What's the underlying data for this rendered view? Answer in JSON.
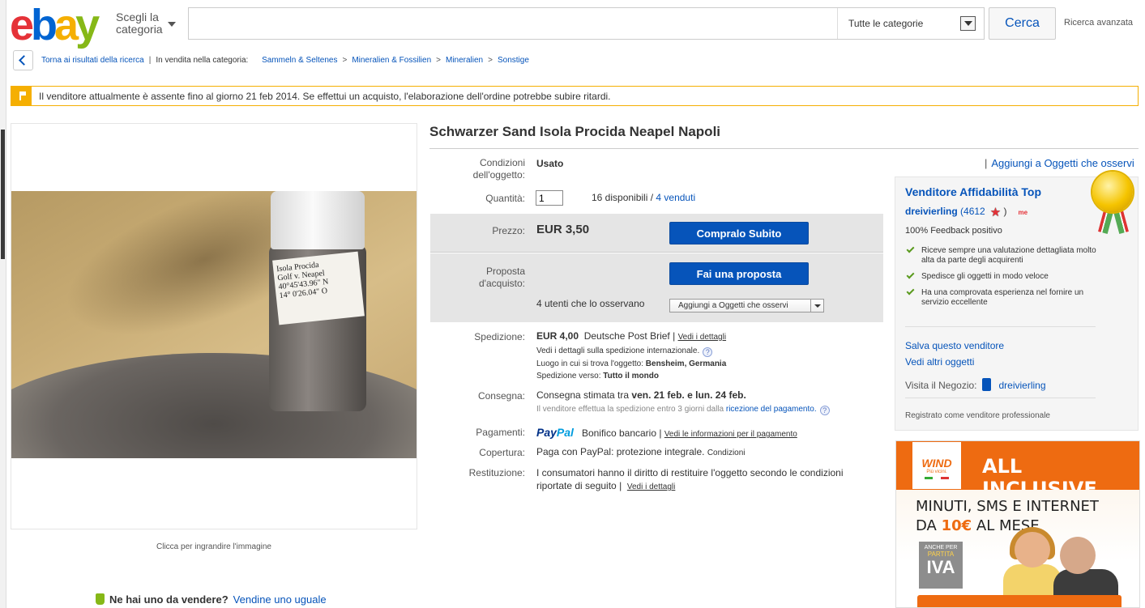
{
  "header": {
    "logo": {
      "e": "e",
      "b": "b",
      "a": "a",
      "y": "y"
    },
    "category_button": {
      "line1": "Scegli la",
      "line2": "categoria"
    },
    "search": {
      "value": "",
      "placeholder": ""
    },
    "category_select": "Tutte le categorie",
    "search_button": "Cerca",
    "advanced_search": "Ricerca avanzata"
  },
  "breadcrumb": {
    "back_label": "Torna ai risultati della ricerca",
    "prefix": "In vendita nella categoria:",
    "items": [
      "Sammeln & Seltenes",
      "Mineralien & Fossilien",
      "Mineralien",
      "Sonstige"
    ]
  },
  "notice": {
    "text": "Il venditore attualmente è assente fino al giorno 21 feb 2014. Se effettui un acquisto, l'elaborazione dell'ordine potrebbe subire ritardi."
  },
  "image": {
    "caption": "Clicca per ingrandire l'immagine",
    "jar_label": [
      "Isola Procida",
      "Golf v. Neapel",
      "40°45'43.96\" N",
      "14° 0'26.04\" O"
    ]
  },
  "sell_similar": {
    "question": "Ne hai uno da vendere?",
    "link": "Vendine uno uguale"
  },
  "item": {
    "title": "Schwarzer Sand Isola Procida Neapel Napoli",
    "watch_link": "Aggiungi a Oggetti che osservi",
    "condition_label": "Condizioni dell'oggetto:",
    "condition_value": "Usato",
    "quantity_label": "Quantità:",
    "quantity_value": "1",
    "available": "16 disponibili",
    "sold": "4 venduti",
    "price_label": "Prezzo:",
    "price_value": "EUR 3,50",
    "buy_button": "Compralo Subito",
    "offer_label": "Proposta d'acquisto:",
    "offer_button": "Fai una proposta",
    "watchers": "4 utenti che lo osservano",
    "watch_dropdown": "Aggiungi a Oggetti che osservi",
    "shipping_label": "Spedizione:",
    "shipping_price": "EUR 4,00",
    "shipping_service": "Deutsche Post Brief",
    "shipping_details": "Vedi i dettagli",
    "shipping_intl": "Vedi i dettagli sulla spedizione internazionale.",
    "location_label": "Luogo in cui si trova l'oggetto:",
    "location_value": "Bensheim, Germania",
    "ships_to_label": "Spedizione verso:",
    "ships_to_value": "Tutto il mondo",
    "delivery_label": "Consegna:",
    "delivery_prefix": "Consegna stimata tra",
    "delivery_dates": "ven. 21 feb. e lun. 24 feb.",
    "delivery_note": "Il venditore effettua la spedizione entro 3 giorni dalla",
    "delivery_note_link": "ricezione del pagamento.",
    "payment_label": "Pagamenti:",
    "paypal_a": "Pay",
    "paypal_b": "Pal",
    "payment_other": "Bonifico bancario",
    "payment_info": "Vedi le informazioni per il pagamento",
    "coverage_label": "Copertura:",
    "coverage_value": "Paga con PayPal: protezione integrale.",
    "coverage_link": "Condizioni",
    "returns_label": "Restituzione:",
    "returns_value": "I consumatori hanno il diritto di restituire l'oggetto secondo le condizioni riportate di seguito",
    "returns_link": "Vedi i dettagli"
  },
  "seller": {
    "badge": "Venditore Affidabilità Top",
    "name": "dreivierling",
    "score": "(4612",
    "score_close": ")",
    "me_badge": "me",
    "feedback": "100% Feedback positivo",
    "points": [
      "Riceve sempre una valutazione dettagliata molto alta da parte degli acquirenti",
      "Spedisce gli oggetti in modo veloce",
      "Ha una comprovata esperienza nel fornire un servizio eccellente"
    ],
    "save_seller": "Salva questo venditore",
    "other_items": "Vedi altri oggetti",
    "store_label": "Visita il Negozio:",
    "store_name": "dreivierling",
    "registered": "Registrato come venditore professionale"
  },
  "ad": {
    "brand": "WIND",
    "brand_tag": "Più vicini.",
    "headline": "ALL INCLUSIVE",
    "line1": "MINUTI, SMS E INTERNET",
    "line2_prefix": "DA",
    "line2_price": "10€",
    "line2_suffix": "AL MESE",
    "badge_top": "ANCHE PER",
    "badge_mid": "PARTITA",
    "badge_big": "IVA"
  },
  "colors": {
    "accent": "#0654ba",
    "notice_border": "#f5af02",
    "ad_orange": "#ee6b11"
  }
}
